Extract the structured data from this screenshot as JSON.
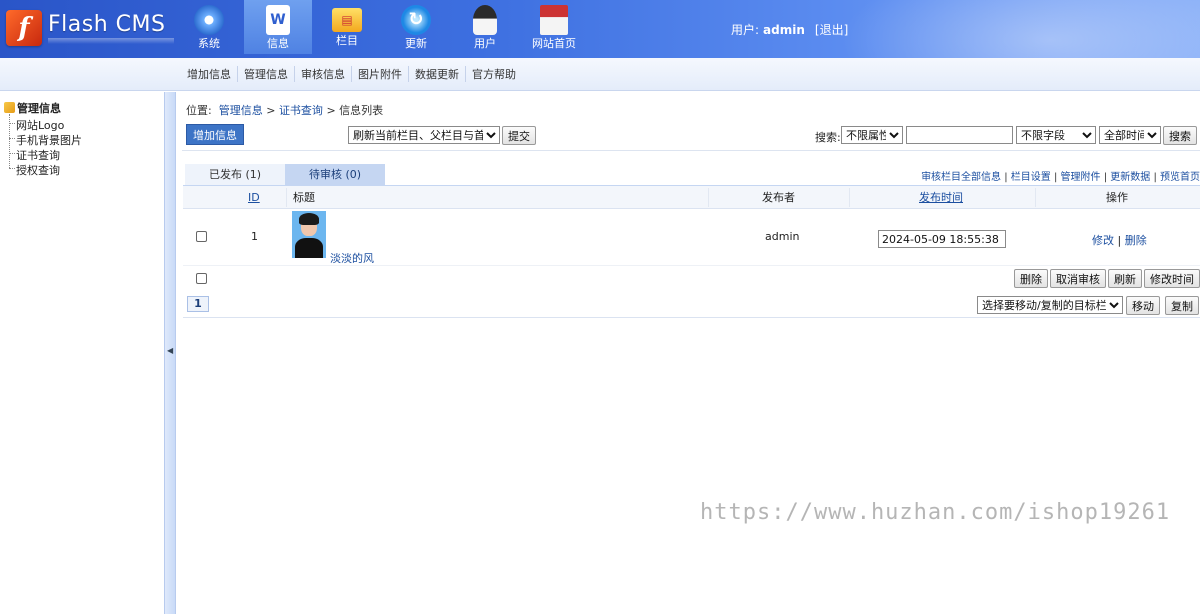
{
  "app": {
    "logo_letter": "f",
    "logo_text": "Flash CMS"
  },
  "topnav": [
    {
      "label": "系统",
      "icon": "settings-icon"
    },
    {
      "label": "信息",
      "icon": "document-icon"
    },
    {
      "label": "栏目",
      "icon": "folder-icon"
    },
    {
      "label": "更新",
      "icon": "refresh-icon"
    },
    {
      "label": "用户",
      "icon": "user-icon"
    },
    {
      "label": "网站首页",
      "icon": "home-icon"
    }
  ],
  "user": {
    "prefix": "用户:",
    "name": "admin",
    "logout": "[退出]"
  },
  "subnav": [
    "增加信息",
    "管理信息",
    "审核信息",
    "图片附件",
    "数据更新",
    "官方帮助"
  ],
  "tree": {
    "root": "管理信息",
    "items": [
      "网站Logo",
      "手机背景图片",
      "证书查询",
      "授权查询"
    ]
  },
  "breadcrumb": {
    "prefix": "位置:",
    "items": [
      "管理信息",
      "证书查询",
      "信息列表"
    ],
    "sep": ">"
  },
  "toolbar": {
    "add_label": "增加信息",
    "refresh_option": "刷新当前栏目、父栏目与首页",
    "submit_label": "提交",
    "search_label": "搜索:",
    "attr_option": "不限属性",
    "search_value": "",
    "field_option": "不限字段",
    "time_option": "全部时间",
    "search_btn": "搜索"
  },
  "tabs": [
    {
      "label": "已发布 (1)"
    },
    {
      "label": "待审核 (0)"
    }
  ],
  "tab_links": [
    "审核栏目全部信息",
    "栏目设置",
    "管理附件",
    "更新数据",
    "预览首页"
  ],
  "table": {
    "headers": {
      "id": "ID",
      "title": "标题",
      "publisher": "发布者",
      "time": "发布时间",
      "actions": "操作"
    },
    "rows": [
      {
        "id": "1",
        "title": "淡淡的风",
        "publisher": "admin",
        "time": "2024-05-09 18:55:38",
        "edit": "修改",
        "delete": "删除"
      }
    ]
  },
  "bulk_actions": [
    "删除",
    "取消审核",
    "刷新",
    "修改时间"
  ],
  "pager": {
    "page": "1"
  },
  "move": {
    "placeholder": "选择要移动/复制的目标栏目",
    "move_label": "移动",
    "copy_label": "复制"
  },
  "watermark": "https://www.huzhan.com/ishop19261"
}
